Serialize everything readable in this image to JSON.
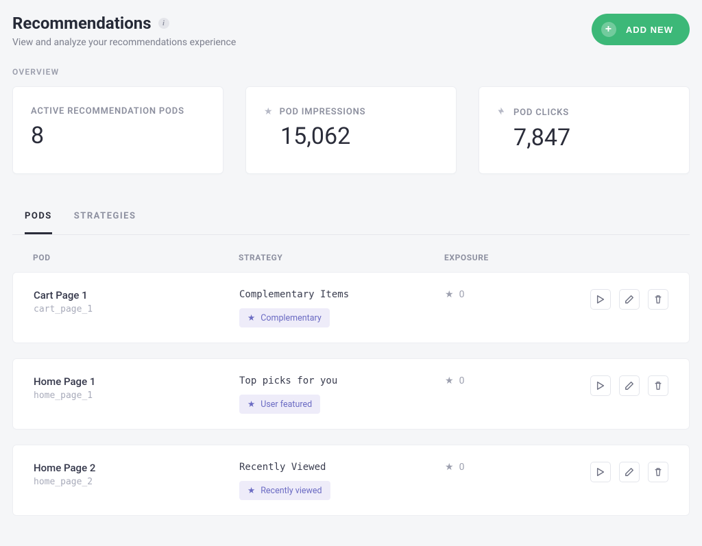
{
  "header": {
    "title": "Recommendations",
    "subtitle": "View and analyze your recommendations experience",
    "add_button": "ADD NEW"
  },
  "overview": {
    "label": "OVERVIEW",
    "stats": [
      {
        "label": "ACTIVE RECOMMENDATION PODS",
        "value": "8",
        "icon": null
      },
      {
        "label": "POD IMPRESSIONS",
        "value": "15,062",
        "icon": "star"
      },
      {
        "label": "POD CLICKS",
        "value": "7,847",
        "icon": "click"
      }
    ]
  },
  "tabs": [
    {
      "label": "PODS",
      "active": true
    },
    {
      "label": "STRATEGIES",
      "active": false
    }
  ],
  "columns": {
    "pod": "POD",
    "strategy": "STRATEGY",
    "exposure": "EXPOSURE"
  },
  "rows": [
    {
      "name": "Cart Page 1",
      "code": "cart_page_1",
      "strategy": "Complementary Items",
      "tag": "Complementary",
      "exposure": "0"
    },
    {
      "name": "Home Page 1",
      "code": "home_page_1",
      "strategy": "Top picks for you",
      "tag": "User featured",
      "exposure": "0"
    },
    {
      "name": "Home Page 2",
      "code": "home_page_2",
      "strategy": "Recently Viewed",
      "tag": "Recently viewed",
      "exposure": "0"
    }
  ]
}
